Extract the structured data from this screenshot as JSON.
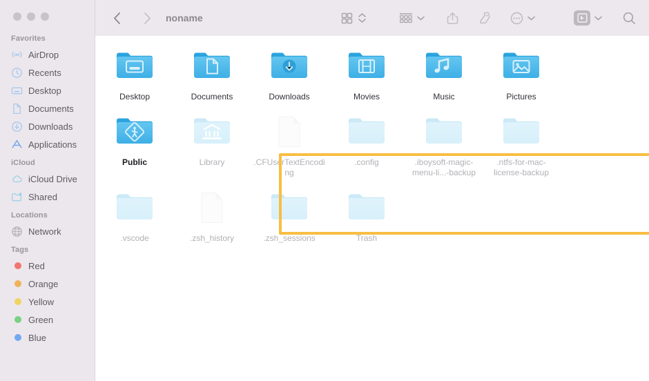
{
  "window": {
    "title": "noname",
    "traffic_lights": [
      "close",
      "minimize",
      "maximize"
    ]
  },
  "toolbar": {
    "back_label": "Back",
    "forward_label": "Forward",
    "items": [
      {
        "name": "view-grid-button",
        "icon": "grid-view-icon"
      },
      {
        "name": "view-sort-stepper",
        "icon": "chevron-up-down-icon"
      },
      {
        "name": "group-by-button",
        "icon": "group-items-icon"
      },
      {
        "name": "group-by-chevron",
        "icon": "chevron-down-icon"
      },
      {
        "name": "share-button",
        "icon": "share-icon"
      },
      {
        "name": "tag-button",
        "icon": "tag-icon"
      },
      {
        "name": "more-actions-button",
        "icon": "ellipsis-circle-icon"
      },
      {
        "name": "more-actions-chevron",
        "icon": "chevron-down-icon"
      },
      {
        "name": "screen-capture-button",
        "icon": "screen-capture-icon"
      },
      {
        "name": "screen-capture-chevron",
        "icon": "chevron-down-icon"
      },
      {
        "name": "search-button",
        "icon": "search-icon"
      }
    ]
  },
  "sidebar": {
    "sections": [
      {
        "title": "Favorites",
        "items": [
          {
            "label": "AirDrop",
            "icon": "airdrop-icon"
          },
          {
            "label": "Recents",
            "icon": "clock-icon"
          },
          {
            "label": "Desktop",
            "icon": "desktop-icon"
          },
          {
            "label": "Documents",
            "icon": "document-icon"
          },
          {
            "label": "Downloads",
            "icon": "download-icon"
          },
          {
            "label": "Applications",
            "icon": "applications-icon"
          }
        ]
      },
      {
        "title": "iCloud",
        "items": [
          {
            "label": "iCloud Drive",
            "icon": "cloud-icon"
          },
          {
            "label": "Shared",
            "icon": "shared-folder-icon"
          }
        ]
      },
      {
        "title": "Locations",
        "items": [
          {
            "label": "Network",
            "icon": "globe-icon"
          }
        ]
      },
      {
        "title": "Tags",
        "items": [
          {
            "label": "Red",
            "icon": "tag-dot",
            "color": "#F2756E"
          },
          {
            "label": "Orange",
            "icon": "tag-dot",
            "color": "#F0B25A"
          },
          {
            "label": "Yellow",
            "icon": "tag-dot",
            "color": "#F0D463"
          },
          {
            "label": "Green",
            "icon": "tag-dot",
            "color": "#79D184"
          },
          {
            "label": "Blue",
            "icon": "tag-dot",
            "color": "#74A8F3"
          }
        ]
      }
    ]
  },
  "content": {
    "rows": [
      [
        {
          "label": "Desktop",
          "kind": "folder",
          "emblem": "desktop",
          "dimmed": false,
          "bold": false
        },
        {
          "label": "Documents",
          "kind": "folder",
          "emblem": "document",
          "dimmed": false,
          "bold": false
        },
        {
          "label": "Downloads",
          "kind": "folder",
          "emblem": "download",
          "dimmed": false,
          "bold": false
        },
        {
          "label": "Movies",
          "kind": "folder",
          "emblem": "film",
          "dimmed": false,
          "bold": false
        },
        {
          "label": "Music",
          "kind": "folder",
          "emblem": "music",
          "dimmed": false,
          "bold": false
        },
        {
          "label": "Pictures",
          "kind": "folder",
          "emblem": "photo",
          "dimmed": false,
          "bold": false
        }
      ],
      [
        {
          "label": "Public",
          "kind": "folder",
          "emblem": "pedestrian",
          "dimmed": false,
          "bold": true
        },
        {
          "label": "Library",
          "kind": "folder",
          "emblem": "bank",
          "dimmed": true,
          "bold": false
        },
        {
          "label": ".CFUserTextEncoding",
          "kind": "file",
          "emblem": "",
          "dimmed": true,
          "bold": false
        },
        {
          "label": ".config",
          "kind": "folder",
          "emblem": "",
          "dimmed": true,
          "bold": false
        },
        {
          "label": ".iboysoft-magic-menu-li...-backup",
          "kind": "folder",
          "emblem": "",
          "dimmed": true,
          "bold": false
        },
        {
          "label": ".ntfs-for-mac-license-backup",
          "kind": "folder",
          "emblem": "",
          "dimmed": true,
          "bold": false
        }
      ],
      [
        {
          "label": ".vscode",
          "kind": "folder",
          "emblem": "",
          "dimmed": true,
          "bold": false
        },
        {
          "label": ".zsh_history",
          "kind": "file",
          "emblem": "",
          "dimmed": true,
          "bold": false
        },
        {
          "label": ".zsh_sessions",
          "kind": "folder",
          "emblem": "",
          "dimmed": true,
          "bold": false
        },
        {
          "label": "Trash",
          "kind": "folder",
          "emblem": "",
          "dimmed": true,
          "bold": false
        }
      ]
    ]
  },
  "annotation": {
    "highlight_color": "#F8BE42",
    "name": "hidden-items-highlight"
  }
}
